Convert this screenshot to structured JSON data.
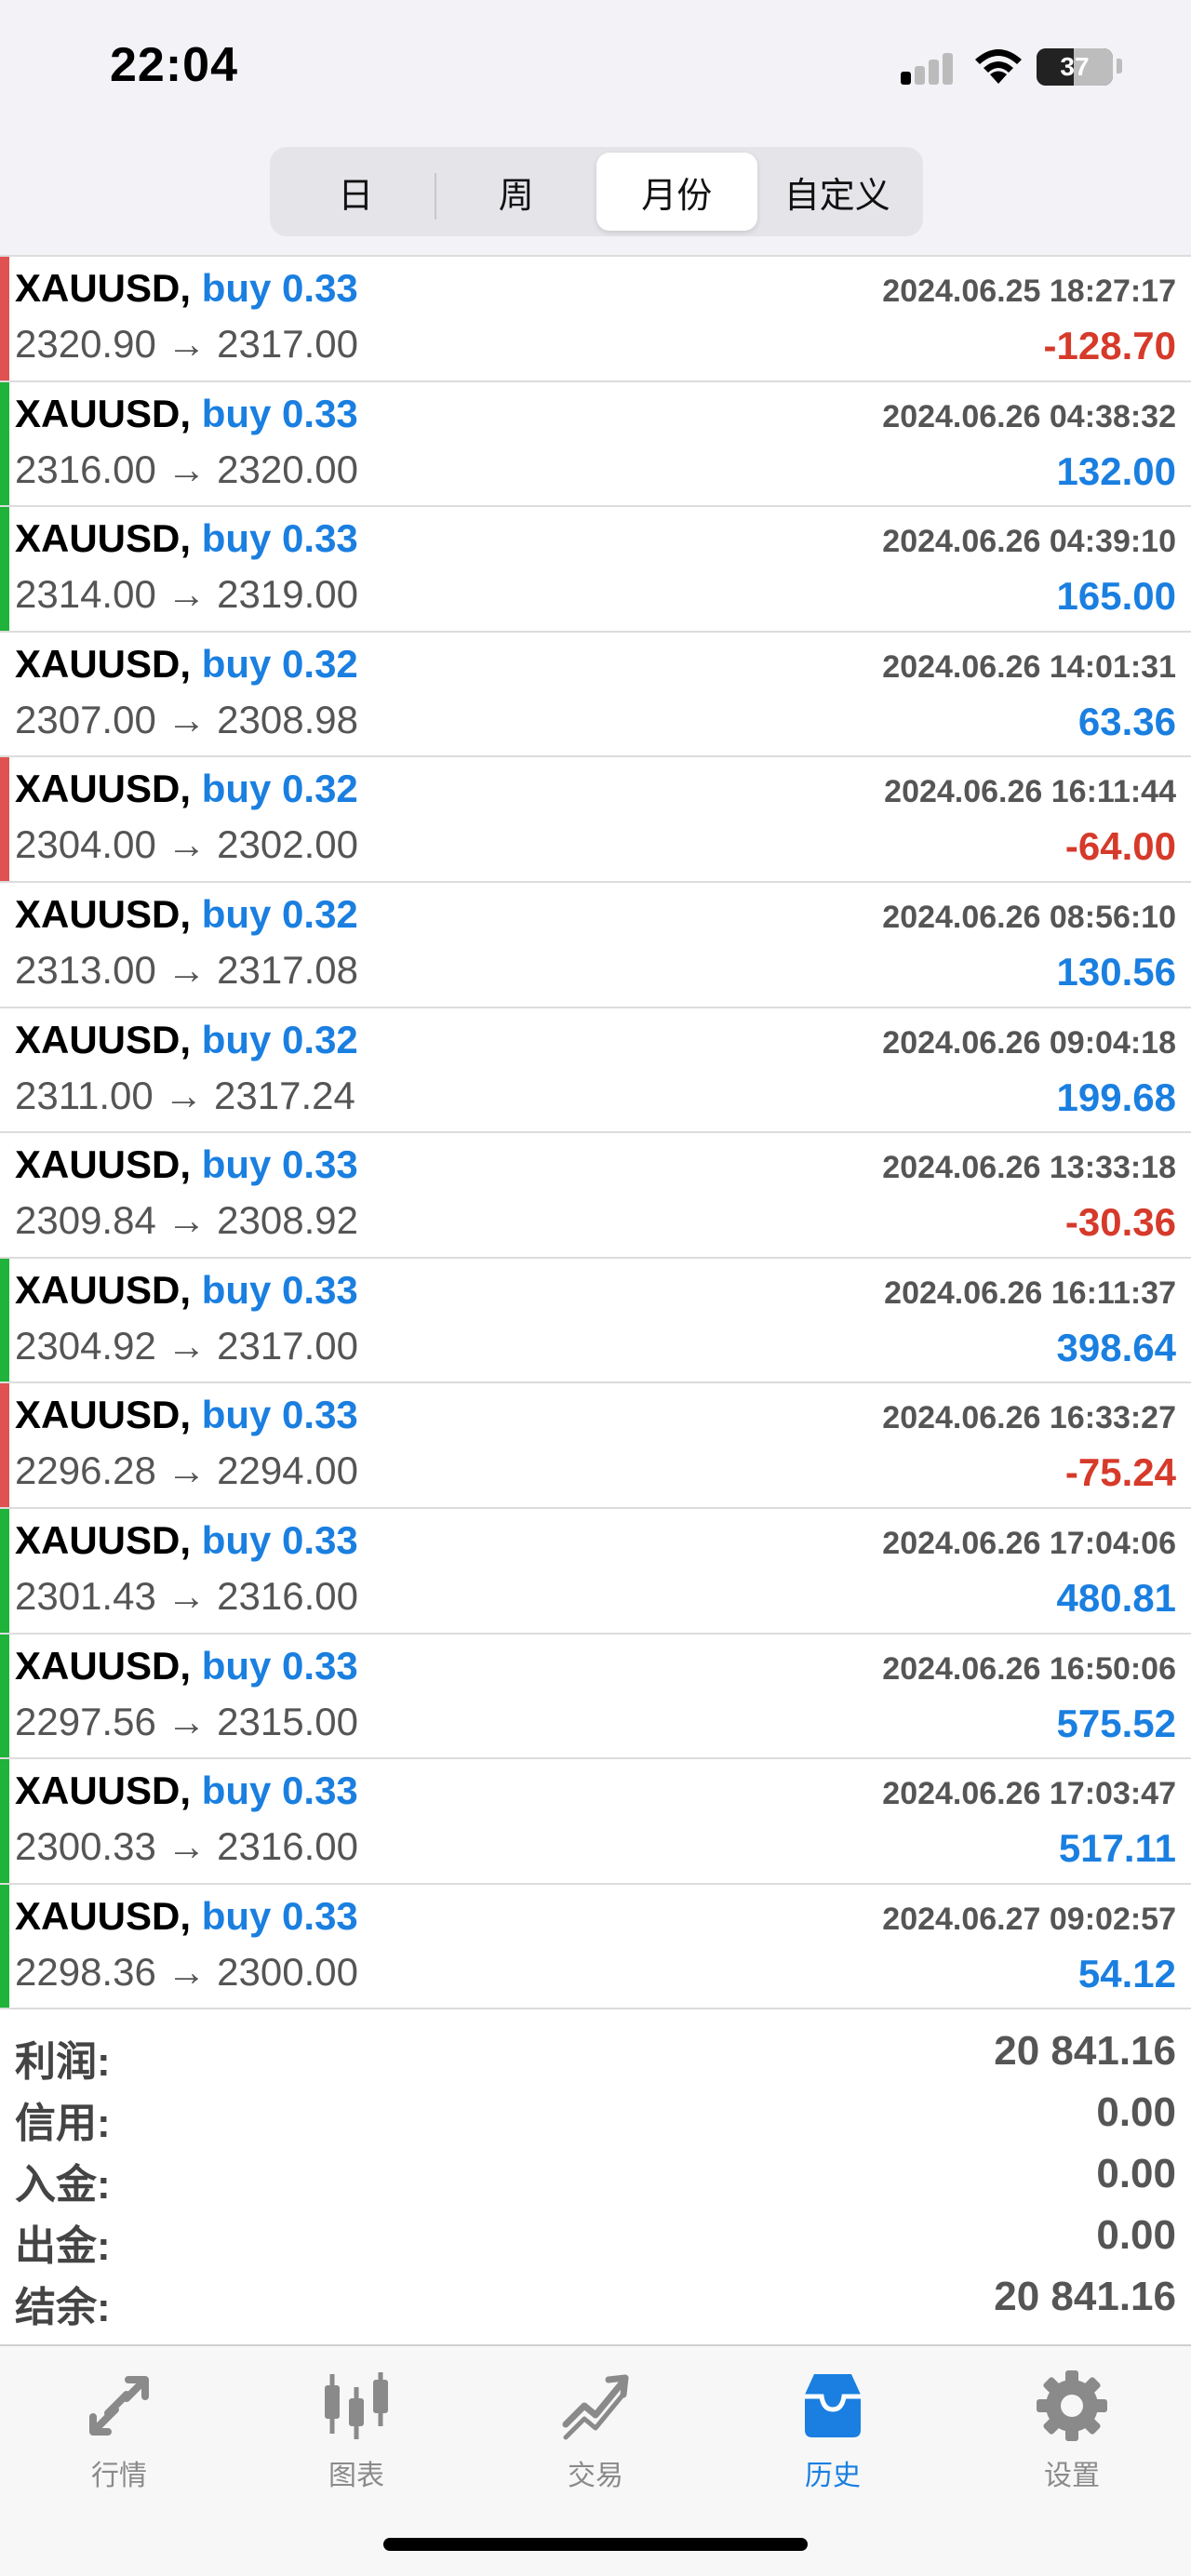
{
  "status_bar": {
    "time": "22:04",
    "battery": "37"
  },
  "segmented": {
    "tabs": [
      "日",
      "周",
      "月份",
      "自定义"
    ],
    "active_index": 2
  },
  "trades": [
    {
      "symbol": "XAUUSD,",
      "direction": "buy 0.33",
      "time": "2024.06.25 18:27:17",
      "prices": "2320.90 → 2317.00",
      "profit": "-128.70",
      "status": "loss"
    },
    {
      "symbol": "XAUUSD,",
      "direction": "buy 0.33",
      "time": "2024.06.26 04:38:32",
      "prices": "2316.00 → 2320.00",
      "profit": "132.00",
      "status": "profit"
    },
    {
      "symbol": "XAUUSD,",
      "direction": "buy 0.33",
      "time": "2024.06.26 04:39:10",
      "prices": "2314.00 → 2319.00",
      "profit": "165.00",
      "status": "profit"
    },
    {
      "symbol": "XAUUSD,",
      "direction": "buy 0.32",
      "time": "2024.06.26 14:01:31",
      "prices": "2307.00 → 2308.98",
      "profit": "63.36",
      "status": "none"
    },
    {
      "symbol": "XAUUSD,",
      "direction": "buy 0.32",
      "time": "2024.06.26 16:11:44",
      "prices": "2304.00 → 2302.00",
      "profit": "-64.00",
      "status": "loss"
    },
    {
      "symbol": "XAUUSD,",
      "direction": "buy 0.32",
      "time": "2024.06.26 08:56:10",
      "prices": "2313.00 → 2317.08",
      "profit": "130.56",
      "status": "none"
    },
    {
      "symbol": "XAUUSD,",
      "direction": "buy 0.32",
      "time": "2024.06.26 09:04:18",
      "prices": "2311.00 → 2317.24",
      "profit": "199.68",
      "status": "none"
    },
    {
      "symbol": "XAUUSD,",
      "direction": "buy 0.33",
      "time": "2024.06.26 13:33:18",
      "prices": "2309.84 → 2308.92",
      "profit": "-30.36",
      "status": "none"
    },
    {
      "symbol": "XAUUSD,",
      "direction": "buy 0.33",
      "time": "2024.06.26 16:11:37",
      "prices": "2304.92 → 2317.00",
      "profit": "398.64",
      "status": "profit"
    },
    {
      "symbol": "XAUUSD,",
      "direction": "buy 0.33",
      "time": "2024.06.26 16:33:27",
      "prices": "2296.28 → 2294.00",
      "profit": "-75.24",
      "status": "loss"
    },
    {
      "symbol": "XAUUSD,",
      "direction": "buy 0.33",
      "time": "2024.06.26 17:04:06",
      "prices": "2301.43 → 2316.00",
      "profit": "480.81",
      "status": "profit"
    },
    {
      "symbol": "XAUUSD,",
      "direction": "buy 0.33",
      "time": "2024.06.26 16:50:06",
      "prices": "2297.56 → 2315.00",
      "profit": "575.52",
      "status": "profit"
    },
    {
      "symbol": "XAUUSD,",
      "direction": "buy 0.33",
      "time": "2024.06.26 17:03:47",
      "prices": "2300.33 → 2316.00",
      "profit": "517.11",
      "status": "profit"
    },
    {
      "symbol": "XAUUSD,",
      "direction": "buy 0.33",
      "time": "2024.06.27 09:02:57",
      "prices": "2298.36 → 2300.00",
      "profit": "54.12",
      "status": "profit"
    }
  ],
  "summary": [
    {
      "label": "利润:",
      "value": "20 841.16"
    },
    {
      "label": "信用:",
      "value": "0.00"
    },
    {
      "label": "入金:",
      "value": "0.00"
    },
    {
      "label": "出金:",
      "value": "0.00"
    },
    {
      "label": "结余:",
      "value": "20 841.16"
    }
  ],
  "tab_bar": {
    "items": [
      {
        "label": "行情",
        "icon": "quotes-icon"
      },
      {
        "label": "图表",
        "icon": "chart-icon"
      },
      {
        "label": "交易",
        "icon": "trade-icon"
      },
      {
        "label": "历史",
        "icon": "history-icon"
      },
      {
        "label": "设置",
        "icon": "settings-icon"
      }
    ],
    "active_index": 3
  },
  "colors": {
    "accent": "#1a7fe0",
    "loss": "#d63a2a",
    "profit_bar": "#1fb33a",
    "loss_bar": "#e05252"
  }
}
